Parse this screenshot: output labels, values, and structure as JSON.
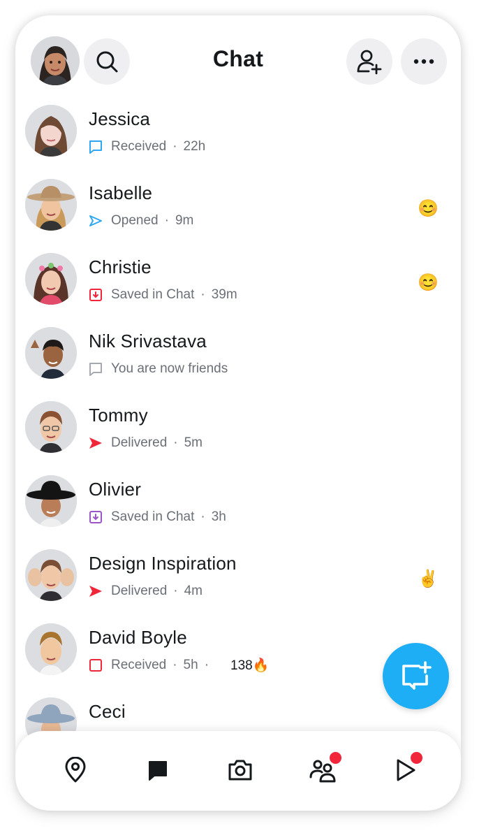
{
  "header": {
    "title": "Chat",
    "search_icon": "search-icon",
    "add_friend_icon": "add-friend-icon",
    "more_icon": "more-icon"
  },
  "chats": [
    {
      "name": "Jessica",
      "status": "Received",
      "time": "22h",
      "icon": "received-chat-blue",
      "icon_color": "#2fa7f2"
    },
    {
      "name": "Isabelle",
      "status": "Opened",
      "time": "9m",
      "icon": "opened-arrow-blue",
      "icon_color": "#2fa7f2",
      "emoji": "😊"
    },
    {
      "name": "Christie",
      "status": "Saved in Chat",
      "time": "39m",
      "icon": "saved-red",
      "icon_color": "#f2263b",
      "emoji": "😊"
    },
    {
      "name": "Nik Srivastava",
      "status": "You are now friends",
      "icon": "friends-chat-gray",
      "icon_color": "#a5a8ae"
    },
    {
      "name": "Tommy",
      "status": "Delivered",
      "time": "5m",
      "icon": "delivered-arrow-red",
      "icon_color": "#f2263b"
    },
    {
      "name": "Olivier",
      "status": "Saved in Chat",
      "time": "3h",
      "icon": "saved-purple",
      "icon_color": "#9b55c9"
    },
    {
      "name": "Design Inspiration",
      "status": "Delivered",
      "time": "4m",
      "icon": "delivered-arrow-red",
      "icon_color": "#f2263b",
      "emoji": "✌️"
    },
    {
      "name": "David Boyle",
      "status": "Received",
      "time": "5h",
      "icon": "received-snap-red",
      "icon_color": "#f2263b",
      "streak": "138🔥"
    },
    {
      "name": "Ceci",
      "status": "",
      "icon": "",
      "icon_color": "#f2263b"
    }
  ],
  "fab": {
    "icon": "new-chat-icon",
    "color": "#1eaef5"
  },
  "bottom_nav": [
    {
      "icon": "map-icon",
      "badge": false
    },
    {
      "icon": "chat-icon",
      "badge": false,
      "active": true
    },
    {
      "icon": "camera-icon",
      "badge": false
    },
    {
      "icon": "stories-icon",
      "badge": true
    },
    {
      "icon": "spotlight-icon",
      "badge": true
    }
  ],
  "colors": {
    "badge": "#f2263b",
    "text": "#16191c",
    "secondary_text": "#6b6f76"
  }
}
